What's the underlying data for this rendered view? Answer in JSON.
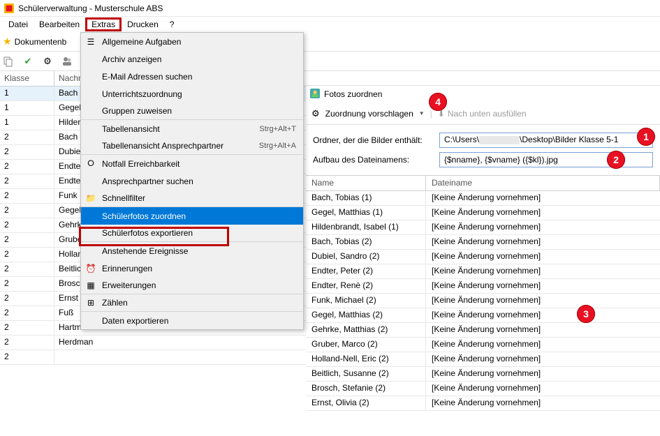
{
  "window_title": "Schülerverwaltung - Musterschule ABS",
  "menubar": [
    "Datei",
    "Bearbeiten",
    "Extras",
    "Drucken",
    "?"
  ],
  "boxed_menu_index": 2,
  "toolbar_doc_label": "Dokumentenb",
  "grid": {
    "col_klasse": "Klasse",
    "col_nach": "Nachname",
    "rows": [
      {
        "k": "1",
        "n": "Bach",
        "sel": true
      },
      {
        "k": "1",
        "n": "Gegel"
      },
      {
        "k": "1",
        "n": "Hildenbra"
      },
      {
        "k": "2",
        "n": "Bach"
      },
      {
        "k": "2",
        "n": "Dubiel"
      },
      {
        "k": "2",
        "n": "Endter"
      },
      {
        "k": "2",
        "n": "Endter"
      },
      {
        "k": "2",
        "n": "Funk"
      },
      {
        "k": "2",
        "n": "Gegel"
      },
      {
        "k": "2",
        "n": "Gehrke"
      },
      {
        "k": "2",
        "n": "Gruber"
      },
      {
        "k": "2",
        "n": "Holland-"
      },
      {
        "k": "2",
        "n": "Beitlich"
      },
      {
        "k": "2",
        "n": "Brosch"
      },
      {
        "k": "2",
        "n": "Ernst"
      },
      {
        "k": "2",
        "n": "Fuß"
      },
      {
        "k": "2",
        "n": "Hartman"
      },
      {
        "k": "2",
        "n": "Herdman"
      },
      {
        "k": "2",
        "n": ""
      }
    ]
  },
  "dropdown": {
    "items": [
      {
        "label": "Allgemeine Aufgaben",
        "icon": "list"
      },
      {
        "label": "Archiv anzeigen"
      },
      {
        "label": "E-Mail Adressen suchen"
      },
      {
        "label": "Unterrichtszuordnung"
      },
      {
        "label": "Gruppen zuweisen",
        "sep": true
      },
      {
        "label": "Tabellenansicht",
        "shortcut": "Strg+Alt+T"
      },
      {
        "label": "Tabellenansicht Ansprechpartner",
        "shortcut": "Strg+Alt+A",
        "sep": true
      },
      {
        "label": "Notfall Erreichbarkeit",
        "icon": "life-ring"
      },
      {
        "label": "Ansprechpartner suchen"
      },
      {
        "label": "Schnellfilter",
        "icon": "folder",
        "sep": true
      },
      {
        "label": "Schülerfotos zuordnen",
        "highlight": true
      },
      {
        "label": "Schülerfotos exportieren",
        "sep": true
      },
      {
        "label": "Anstehende Ereignisse"
      },
      {
        "label": "Erinnerungen",
        "icon": "alarm"
      },
      {
        "label": "Erweiterungen",
        "icon": "apps",
        "sep": true
      },
      {
        "label": "Zählen",
        "icon": "count",
        "sep": true
      },
      {
        "label": "Daten exportieren"
      }
    ]
  },
  "dialog": {
    "title": "Fotos zuordnen",
    "bar_label": "Zuordnung vorschlagen",
    "bar_grey": "Nach unten ausfüllen",
    "label_ordner": "Ordner, der die Bilder enthält:",
    "path_prefix": "C:\\Users\\",
    "path_suffix": "\\Desktop\\Bilder Klasse 5-1",
    "label_aufbau": "Aufbau des Dateinamens:",
    "pattern_value": "{$nname}, {$vname} ({$kl}).jpg",
    "th_name": "Name",
    "th_file": "Dateiname",
    "rows": [
      {
        "name": "Bach, Tobias (1)",
        "file": "[Keine Änderung vornehmen]"
      },
      {
        "name": "Gegel, Matthias (1)",
        "file": "[Keine Änderung vornehmen]"
      },
      {
        "name": "Hildenbrandt, Isabel (1)",
        "file": "[Keine Änderung vornehmen]"
      },
      {
        "name": "Bach, Tobias (2)",
        "file": "[Keine Änderung vornehmen]"
      },
      {
        "name": "Dubiel, Sandro (2)",
        "file": "[Keine Änderung vornehmen]"
      },
      {
        "name": "Endter, Peter (2)",
        "file": "[Keine Änderung vornehmen]"
      },
      {
        "name": "Endter, Renè (2)",
        "file": "[Keine Änderung vornehmen]"
      },
      {
        "name": "Funk, Michael (2)",
        "file": "[Keine Änderung vornehmen]"
      },
      {
        "name": "Gegel, Matthias (2)",
        "file": "[Keine Änderung vornehmen]"
      },
      {
        "name": "Gehrke, Matthias (2)",
        "file": "[Keine Änderung vornehmen]"
      },
      {
        "name": "Gruber, Marco (2)",
        "file": "[Keine Änderung vornehmen]"
      },
      {
        "name": "Holland-Nell, Eric (2)",
        "file": "[Keine Änderung vornehmen]"
      },
      {
        "name": "Beitlich, Susanne (2)",
        "file": "[Keine Änderung vornehmen]"
      },
      {
        "name": "Brosch, Stefanie (2)",
        "file": "[Keine Änderung vornehmen]"
      },
      {
        "name": "Ernst, Olivia (2)",
        "file": "[Keine Änderung vornehmen]"
      }
    ]
  },
  "badges": {
    "b1": "1",
    "b2": "2",
    "b3": "3",
    "b4": "4"
  }
}
